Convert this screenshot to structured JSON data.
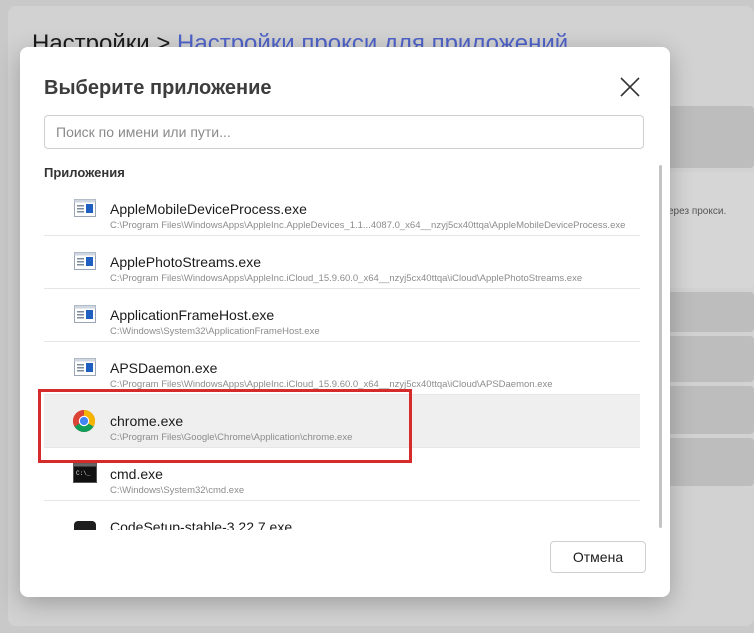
{
  "background": {
    "title_prefix": "Настройки > ",
    "title_crumb": "Настройки прокси для приложений",
    "side_text": "ерез прокси."
  },
  "dialog": {
    "title": "Выберите приложение",
    "search_placeholder": "Поиск по имени или пути...",
    "section_label": "Приложения",
    "cancel_label": "Отмена"
  },
  "apps": [
    {
      "name": "AppleMobileDeviceProcess.exe",
      "path": "C:\\Program Files\\WindowsApps\\AppleInc.AppleDevices_1.1...4087.0_x64__nzyj5cx40ttqa\\AppleMobileDeviceProcess.exe",
      "icon": "window-app-icon"
    },
    {
      "name": "ApplePhotoStreams.exe",
      "path": "C:\\Program Files\\WindowsApps\\AppleInc.iCloud_15.9.60.0_x64__nzyj5cx40ttqa\\iCloud\\ApplePhotoStreams.exe",
      "icon": "window-app-icon"
    },
    {
      "name": "ApplicationFrameHost.exe",
      "path": "C:\\Windows\\System32\\ApplicationFrameHost.exe",
      "icon": "window-app-icon"
    },
    {
      "name": "APSDaemon.exe",
      "path": "C:\\Program Files\\WindowsApps\\AppleInc.iCloud_15.9.60.0_x64__nzyj5cx40ttqa\\iCloud\\APSDaemon.exe",
      "icon": "window-app-icon"
    },
    {
      "name": "chrome.exe",
      "path": "C:\\Program Files\\Google\\Chrome\\Application\\chrome.exe",
      "icon": "chrome-icon",
      "selected": true
    },
    {
      "name": "cmd.exe",
      "path": "C:\\Windows\\System32\\cmd.exe",
      "icon": "terminal-icon"
    },
    {
      "name": "CodeSetup-stable-3.22.7.exe",
      "path": "",
      "icon": "installer-icon"
    }
  ],
  "colors": {
    "accent": "#4f63c9",
    "highlight": "#d62b2b"
  }
}
